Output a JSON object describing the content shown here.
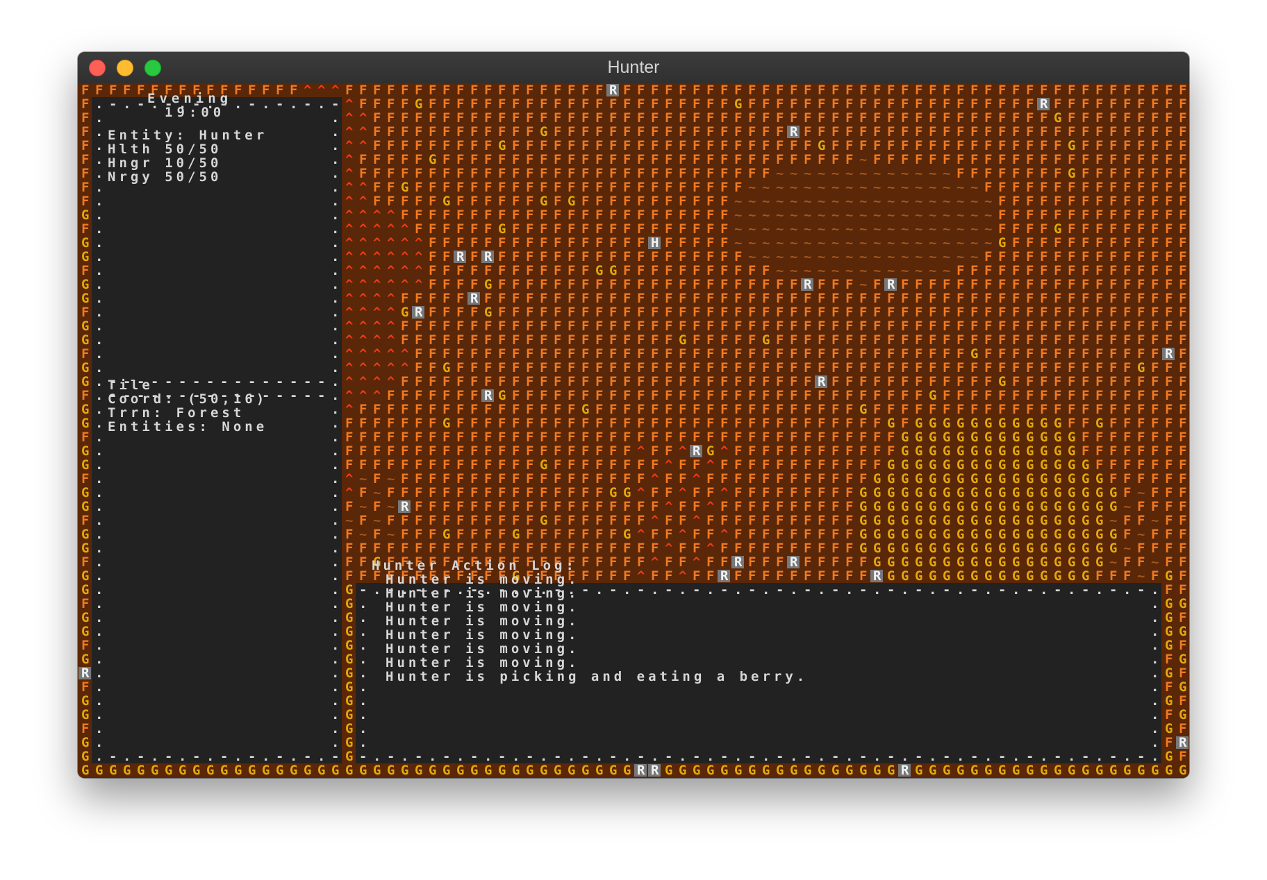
{
  "window": {
    "title": "Hunter",
    "controls": [
      "close",
      "minimize",
      "zoom"
    ]
  },
  "status_panel": {
    "time_of_day": "Evening",
    "clock": "19:00",
    "entity_line": "Entity: Hunter",
    "health_line": "Hlth 50/50",
    "hunger_line": "Hngr 10/50",
    "energy_line": "Nrgy 50/50"
  },
  "tile_panel": {
    "heading": "Tile",
    "coord_line": "Coord: (50,16)",
    "terrain_line": "Trrn: Forest",
    "entities_line": "Entities: None"
  },
  "action_log": {
    "heading": "Hunter Action Log:",
    "entries": [
      "Hunter is moving.",
      "Hunter is moving.",
      "Hunter is moving.",
      "Hunter is moving.",
      "Hunter is moving.",
      "Hunter is moving.",
      "Hunter is moving.",
      "Hunter is picking and eating a berry."
    ]
  },
  "legend_glyphs": {
    "mountain": "^",
    "forest": "F",
    "grass": "G",
    "water": "~",
    "rabbit": "R",
    "hunter": "H"
  },
  "map_markers": {
    "hunter": {
      "col": 41,
      "row": 11
    },
    "rabbits": [
      [
        38,
        0
      ],
      [
        51,
        3
      ],
      [
        69,
        1
      ],
      [
        27,
        12
      ],
      [
        29,
        12
      ],
      [
        28,
        15
      ],
      [
        24,
        16
      ],
      [
        52,
        14
      ],
      [
        58,
        14
      ],
      [
        78,
        19
      ],
      [
        53,
        21
      ],
      [
        29,
        22
      ],
      [
        44,
        26
      ],
      [
        23,
        30
      ],
      [
        47,
        34
      ],
      [
        51,
        34
      ],
      [
        46,
        35
      ],
      [
        57,
        35
      ],
      [
        0,
        42
      ],
      [
        40,
        49
      ],
      [
        41,
        49
      ],
      [
        59,
        49
      ],
      [
        79,
        47
      ]
    ]
  },
  "colors": {
    "terminal_bg": "#222222",
    "map_bg": "#5a2708",
    "forest": "#f07a22",
    "grass": "#e3a80c",
    "mountain": "#ee3c19",
    "water": "#a0561e",
    "entity_tile_bg": "#77787a",
    "entity_text": "#f2f2f2",
    "panel_text": "#d6d6d6",
    "titlebar": "#363636",
    "title_text": "#d4d4d4"
  }
}
